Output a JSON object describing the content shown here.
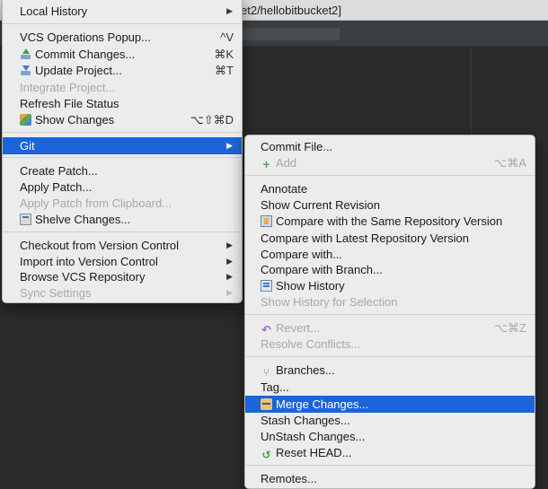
{
  "window": {
    "title_fragment": "et2/hellobitbucket2]"
  },
  "vcs_menu": {
    "items": [
      {
        "label": "Local History",
        "submenu": true
      },
      {
        "label": "VCS Operations Popup...",
        "shortcut": "^V"
      },
      {
        "label": "Commit Changes...",
        "shortcut": "⌘K",
        "icon": "commit-icon"
      },
      {
        "label": "Update Project...",
        "shortcut": "⌘T",
        "icon": "update-icon"
      },
      {
        "label": "Integrate Project...",
        "disabled": true
      },
      {
        "label": "Refresh File Status"
      },
      {
        "label": "Show Changes",
        "shortcut": "⌥⇧⌘D",
        "icon": "changes-icon"
      },
      {
        "label": "Git",
        "submenu": true,
        "selected": true
      },
      {
        "label": "Create Patch..."
      },
      {
        "label": "Apply Patch..."
      },
      {
        "label": "Apply Patch from Clipboard...",
        "disabled": true
      },
      {
        "label": "Shelve Changes...",
        "icon": "shelve-icon"
      },
      {
        "label": "Checkout from Version Control",
        "submenu": true
      },
      {
        "label": "Import into Version Control",
        "submenu": true
      },
      {
        "label": "Browse VCS Repository",
        "submenu": true
      },
      {
        "label": "Sync Settings",
        "submenu": true,
        "disabled": true
      }
    ]
  },
  "git_menu": {
    "items": [
      {
        "label": "Commit File..."
      },
      {
        "label": "Add",
        "shortcut": "⌥⌘A",
        "disabled": true,
        "icon": "add-icon"
      },
      {
        "label": "Annotate"
      },
      {
        "label": "Show Current Revision"
      },
      {
        "label": "Compare with the Same Repository Version",
        "icon": "compare-icon"
      },
      {
        "label": "Compare with Latest Repository Version"
      },
      {
        "label": "Compare with..."
      },
      {
        "label": "Compare with Branch..."
      },
      {
        "label": "Show History",
        "icon": "history-icon"
      },
      {
        "label": "Show History for Selection",
        "disabled": true
      },
      {
        "label": "Revert...",
        "shortcut": "⌥⌘Z",
        "disabled": true,
        "icon": "revert-icon"
      },
      {
        "label": "Resolve Conflicts...",
        "disabled": true
      },
      {
        "label": "Branches...",
        "icon": "branches-icon"
      },
      {
        "label": "Tag..."
      },
      {
        "label": "Merge Changes...",
        "selected": true,
        "icon": "merge-icon"
      },
      {
        "label": "Stash Changes..."
      },
      {
        "label": "UnStash Changes..."
      },
      {
        "label": "Reset HEAD...",
        "icon": "reset-icon"
      },
      {
        "label": "Remotes..."
      }
    ]
  },
  "colors": {
    "selection": "#1b64da",
    "menu_bg": "#ececec",
    "disabled_text": "#a8a8a8",
    "editor_bg": "#2b2b2b"
  }
}
